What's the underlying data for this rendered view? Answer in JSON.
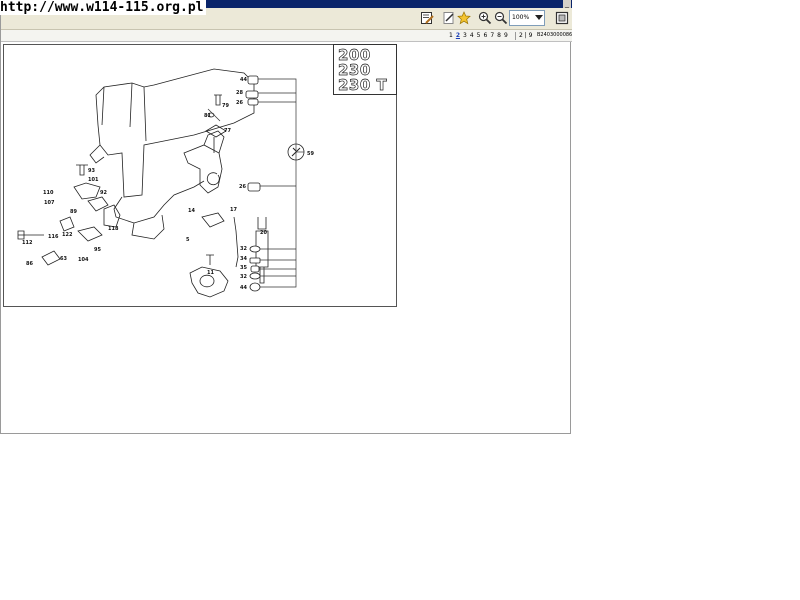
{
  "window": {
    "url_text": "http://www.w114-115.org.pl",
    "minimize_symbol": "_"
  },
  "toolbar": {
    "zoom_value": "100%"
  },
  "navigation": {
    "pages": [
      "1",
      "2",
      "3",
      "4",
      "5",
      "6",
      "7",
      "8",
      "9"
    ],
    "active_page": "2",
    "page_indicator": "2 | 9",
    "document_code": "B2403000086"
  },
  "diagram": {
    "models": [
      "200",
      "230",
      "230 T"
    ],
    "part_labels": {
      "p44a": "44",
      "p28": "28",
      "p26a": "26",
      "p79": "79",
      "p81": "81",
      "p77": "77",
      "p59": "59",
      "p26b": "26",
      "p93": "93",
      "p101": "101",
      "p92": "92",
      "p110": "110",
      "p107": "107",
      "p89": "89",
      "p14": "14",
      "p17": "17",
      "p20": "20",
      "p118": "118",
      "p112": "112",
      "p116": "116",
      "p122": "122",
      "p95": "95",
      "p104": "104",
      "p63": "63",
      "p86": "86",
      "p5": "5",
      "p11": "11",
      "p32a": "32",
      "p34": "34",
      "p35": "35",
      "p32b": "32",
      "p44b": "44"
    }
  }
}
